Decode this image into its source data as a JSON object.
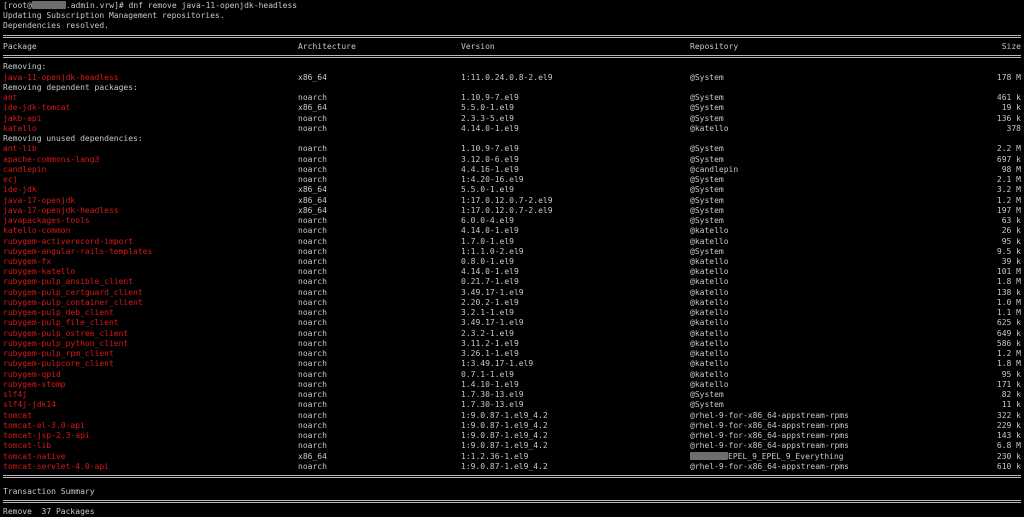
{
  "terminal": {
    "prompt_user": "[root@",
    "prompt_host_suffix": ".admin.vrw]# dnf remove java-11-openjdk-headless",
    "lines": [
      "Updating Subscription Management repositories.",
      "Dependencies resolved."
    ]
  },
  "table": {
    "headers": [
      "Package",
      "Architecture",
      "Version",
      "Repository",
      "Size"
    ],
    "sections": [
      {
        "label": "Removing:",
        "rows": [
          {
            "pkg": "java-11-openjdk-headless",
            "arch": "x86_64",
            "ver": "1:11.0.24.0.8-2.el9",
            "repo": "@System",
            "size": "178 M"
          }
        ]
      },
      {
        "label": "Removing dependent packages:",
        "rows": [
          {
            "pkg": "ant",
            "arch": "noarch",
            "ver": "1.10.9-7.el9",
            "repo": "@System",
            "size": "461 k"
          },
          {
            "pkg": "ide-jdk-tomcat",
            "arch": "x86_64",
            "ver": "5.5.0-1.el9",
            "repo": "@System",
            "size": "19 k"
          },
          {
            "pkg": "jakb-api",
            "arch": "noarch",
            "ver": "2.3.3-5.el9",
            "repo": "@System",
            "size": "136 k"
          },
          {
            "pkg": "katello",
            "arch": "noarch",
            "ver": "4.14.0-1.el9",
            "repo": "@katello",
            "size": "378"
          }
        ]
      },
      {
        "label": "Removing unused dependencies:",
        "rows": [
          {
            "pkg": "ant-lib",
            "arch": "noarch",
            "ver": "1.10.9-7.el9",
            "repo": "@System",
            "size": "2.2 M"
          },
          {
            "pkg": "apache-commons-lang3",
            "arch": "noarch",
            "ver": "3.12.0-6.el9",
            "repo": "@System",
            "size": "697 k"
          },
          {
            "pkg": "candlepin",
            "arch": "noarch",
            "ver": "4.4.16-1.el9",
            "repo": "@candlepin",
            "size": "98 M"
          },
          {
            "pkg": "ecj",
            "arch": "noarch",
            "ver": "1:4.20-16.el9",
            "repo": "@System",
            "size": "2.1 M"
          },
          {
            "pkg": "ide-jdk",
            "arch": "x86_64",
            "ver": "5.5.0-1.el9",
            "repo": "@System",
            "size": "3.2 M"
          },
          {
            "pkg": "java-17-openjdk",
            "arch": "x86_64",
            "ver": "1:17.0.12.0.7-2.el9",
            "repo": "@System",
            "size": "1.2 M"
          },
          {
            "pkg": "java-17-openjdk-headless",
            "arch": "x86_64",
            "ver": "1:17.0.12.0.7-2.el9",
            "repo": "@System",
            "size": "197 M"
          },
          {
            "pkg": "javapackages-tools",
            "arch": "noarch",
            "ver": "6.0.0-4.el9",
            "repo": "@System",
            "size": "63 k"
          },
          {
            "pkg": "katello-common",
            "arch": "noarch",
            "ver": "4.14.0-1.el9",
            "repo": "@katello",
            "size": "26 k"
          },
          {
            "pkg": "rubygem-activerecord-import",
            "arch": "noarch",
            "ver": "1.7.0-1.el9",
            "repo": "@katello",
            "size": "95 k"
          },
          {
            "pkg": "rubygem-angular-rails-templates",
            "arch": "noarch",
            "ver": "1:1.1.0-2.el9",
            "repo": "@System",
            "size": "9.5 k"
          },
          {
            "pkg": "rubygem-fx",
            "arch": "noarch",
            "ver": "0.8.0-1.el9",
            "repo": "@katello",
            "size": "39 k"
          },
          {
            "pkg": "rubygem-katello",
            "arch": "noarch",
            "ver": "4.14.0-1.el9",
            "repo": "@katello",
            "size": "101 M"
          },
          {
            "pkg": "rubygem-pulp_ansible_client",
            "arch": "noarch",
            "ver": "0.21.7-1.el9",
            "repo": "@katello",
            "size": "1.8 M"
          },
          {
            "pkg": "rubygem-pulp_certguard_client",
            "arch": "noarch",
            "ver": "3.49.17-1.el9",
            "repo": "@katello",
            "size": "138 k"
          },
          {
            "pkg": "rubygem-pulp_container_client",
            "arch": "noarch",
            "ver": "2.20.2-1.el9",
            "repo": "@katello",
            "size": "1.0 M"
          },
          {
            "pkg": "rubygem-pulp_deb_client",
            "arch": "noarch",
            "ver": "3.2.1-1.el9",
            "repo": "@katello",
            "size": "1.1 M"
          },
          {
            "pkg": "rubygem-pulp_file_client",
            "arch": "noarch",
            "ver": "3.49.17-1.el9",
            "repo": "@katello",
            "size": "625 k"
          },
          {
            "pkg": "rubygem-pulp_ostree_client",
            "arch": "noarch",
            "ver": "2.3.2-1.el9",
            "repo": "@katello",
            "size": "649 k"
          },
          {
            "pkg": "rubygem-pulp_python_client",
            "arch": "noarch",
            "ver": "3.11.2-1.el9",
            "repo": "@katello",
            "size": "586 k"
          },
          {
            "pkg": "rubygem-pulp_rpm_client",
            "arch": "noarch",
            "ver": "3.26.1-1.el9",
            "repo": "@katello",
            "size": "1.2 M"
          },
          {
            "pkg": "rubygem-pulpcore_client",
            "arch": "noarch",
            "ver": "1:3.49.17-1.el9",
            "repo": "@katello",
            "size": "1.8 M"
          },
          {
            "pkg": "rubygem-qpid",
            "arch": "noarch",
            "ver": "0.7.1-1.el9",
            "repo": "@katello",
            "size": "95 k"
          },
          {
            "pkg": "rubygem-stomp",
            "arch": "noarch",
            "ver": "1.4.10-1.el9",
            "repo": "@katello",
            "size": "171 k"
          },
          {
            "pkg": "slf4j",
            "arch": "noarch",
            "ver": "1.7.30-13.el9",
            "repo": "@System",
            "size": "82 k"
          },
          {
            "pkg": "slf4j-jdk14",
            "arch": "noarch",
            "ver": "1.7.30-13.el9",
            "repo": "@System",
            "size": "11 k"
          },
          {
            "pkg": "tomcat",
            "arch": "noarch",
            "ver": "1:9.0.87-1.el9_4.2",
            "repo": "@rhel-9-for-x86_64-appstream-rpms",
            "size": "322 k"
          },
          {
            "pkg": "tomcat-el-3.0-api",
            "arch": "noarch",
            "ver": "1:9.0.87-1.el9_4.2",
            "repo": "@rhel-9-for-x86_64-appstream-rpms",
            "size": "229 k"
          },
          {
            "pkg": "tomcat-jsp-2.3-api",
            "arch": "noarch",
            "ver": "1:9.0.87-1.el9_4.2",
            "repo": "@rhel-9-for-x86_64-appstream-rpms",
            "size": "143 k"
          },
          {
            "pkg": "tomcat-lib",
            "arch": "noarch",
            "ver": "1:9.0.87-1.el9_4.2",
            "repo": "@rhel-9-for-x86_64-appstream-rpms",
            "size": "6.8 M"
          },
          {
            "pkg": "tomcat-native",
            "arch": "x86_64",
            "ver": "1:1.2.36-1.el9",
            "repo": "EPEL_9_EPEL_9_Everything",
            "size": "230 k",
            "repo_redacted": true
          },
          {
            "pkg": "tomcat-servlet-4.0-api",
            "arch": "noarch",
            "ver": "1:9.0.87-1.el9_4.2",
            "repo": "@rhel-9-for-x86_64-appstream-rpms",
            "size": "610 k"
          }
        ]
      }
    ]
  },
  "summary": {
    "title": "Transaction Summary",
    "line": "Remove  37 Packages"
  },
  "colors": {
    "background": "#000000",
    "text": "#c8c8c8",
    "package_highlight": "#d81818"
  }
}
